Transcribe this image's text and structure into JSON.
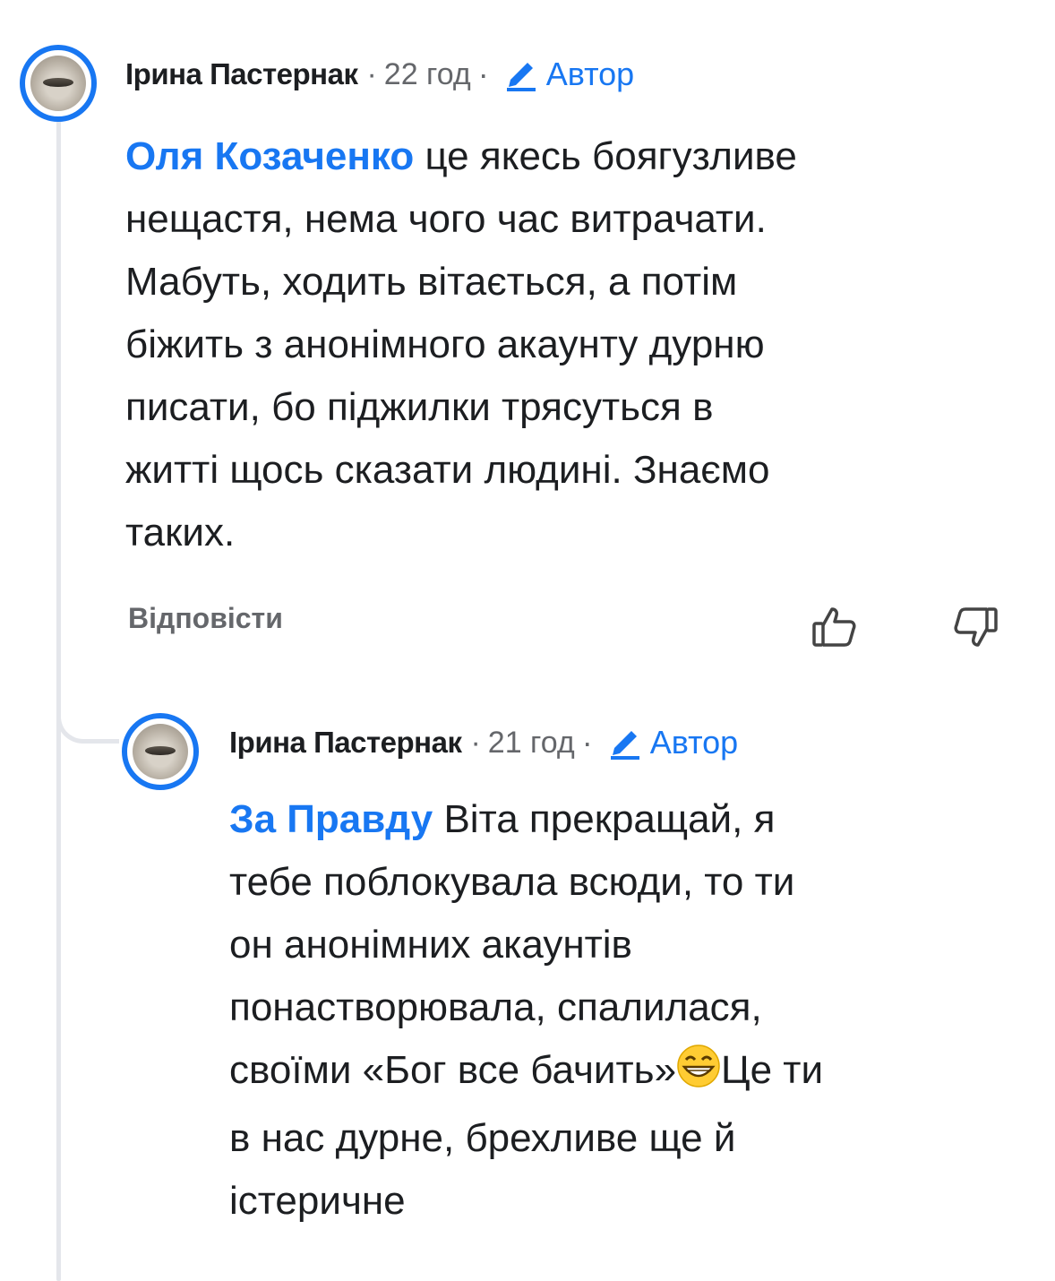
{
  "comments": [
    {
      "author": "Ірина Пастернак",
      "time": "22 год",
      "badge": "Автор",
      "mention": "Оля Козаченко",
      "text_lines": [
        "це якесь боягузливе",
        "нещастя, нема чого час витрачати.",
        "Мабуть, ходить вітається, а потім",
        "біжить з анонімного акаунту дурню",
        "писати, бо піджилки трясуться в",
        "житті щось сказати людині. Знаємо",
        "таких."
      ],
      "reply_label": "Відповісти"
    },
    {
      "author": "Ірина Пастернак",
      "time": "21 год",
      "badge": "Автор",
      "mention": "За Правду",
      "text_lines": [
        "Віта прекращай, я",
        "тебе поблокувала всюди, то ти",
        "он анонімних акаунтів",
        "понастворювала, спалилася,",
        "своїми «Бог все бачить»",
        "Це ти",
        "в нас дурне, брехливе ще й",
        "істеричне"
      ],
      "emoji": "grinning-face-emoji"
    }
  ],
  "separator": "·",
  "colors": {
    "accent": "#1877f2",
    "secondary_text": "#65676b",
    "thread_line": "#e4e6eb"
  }
}
